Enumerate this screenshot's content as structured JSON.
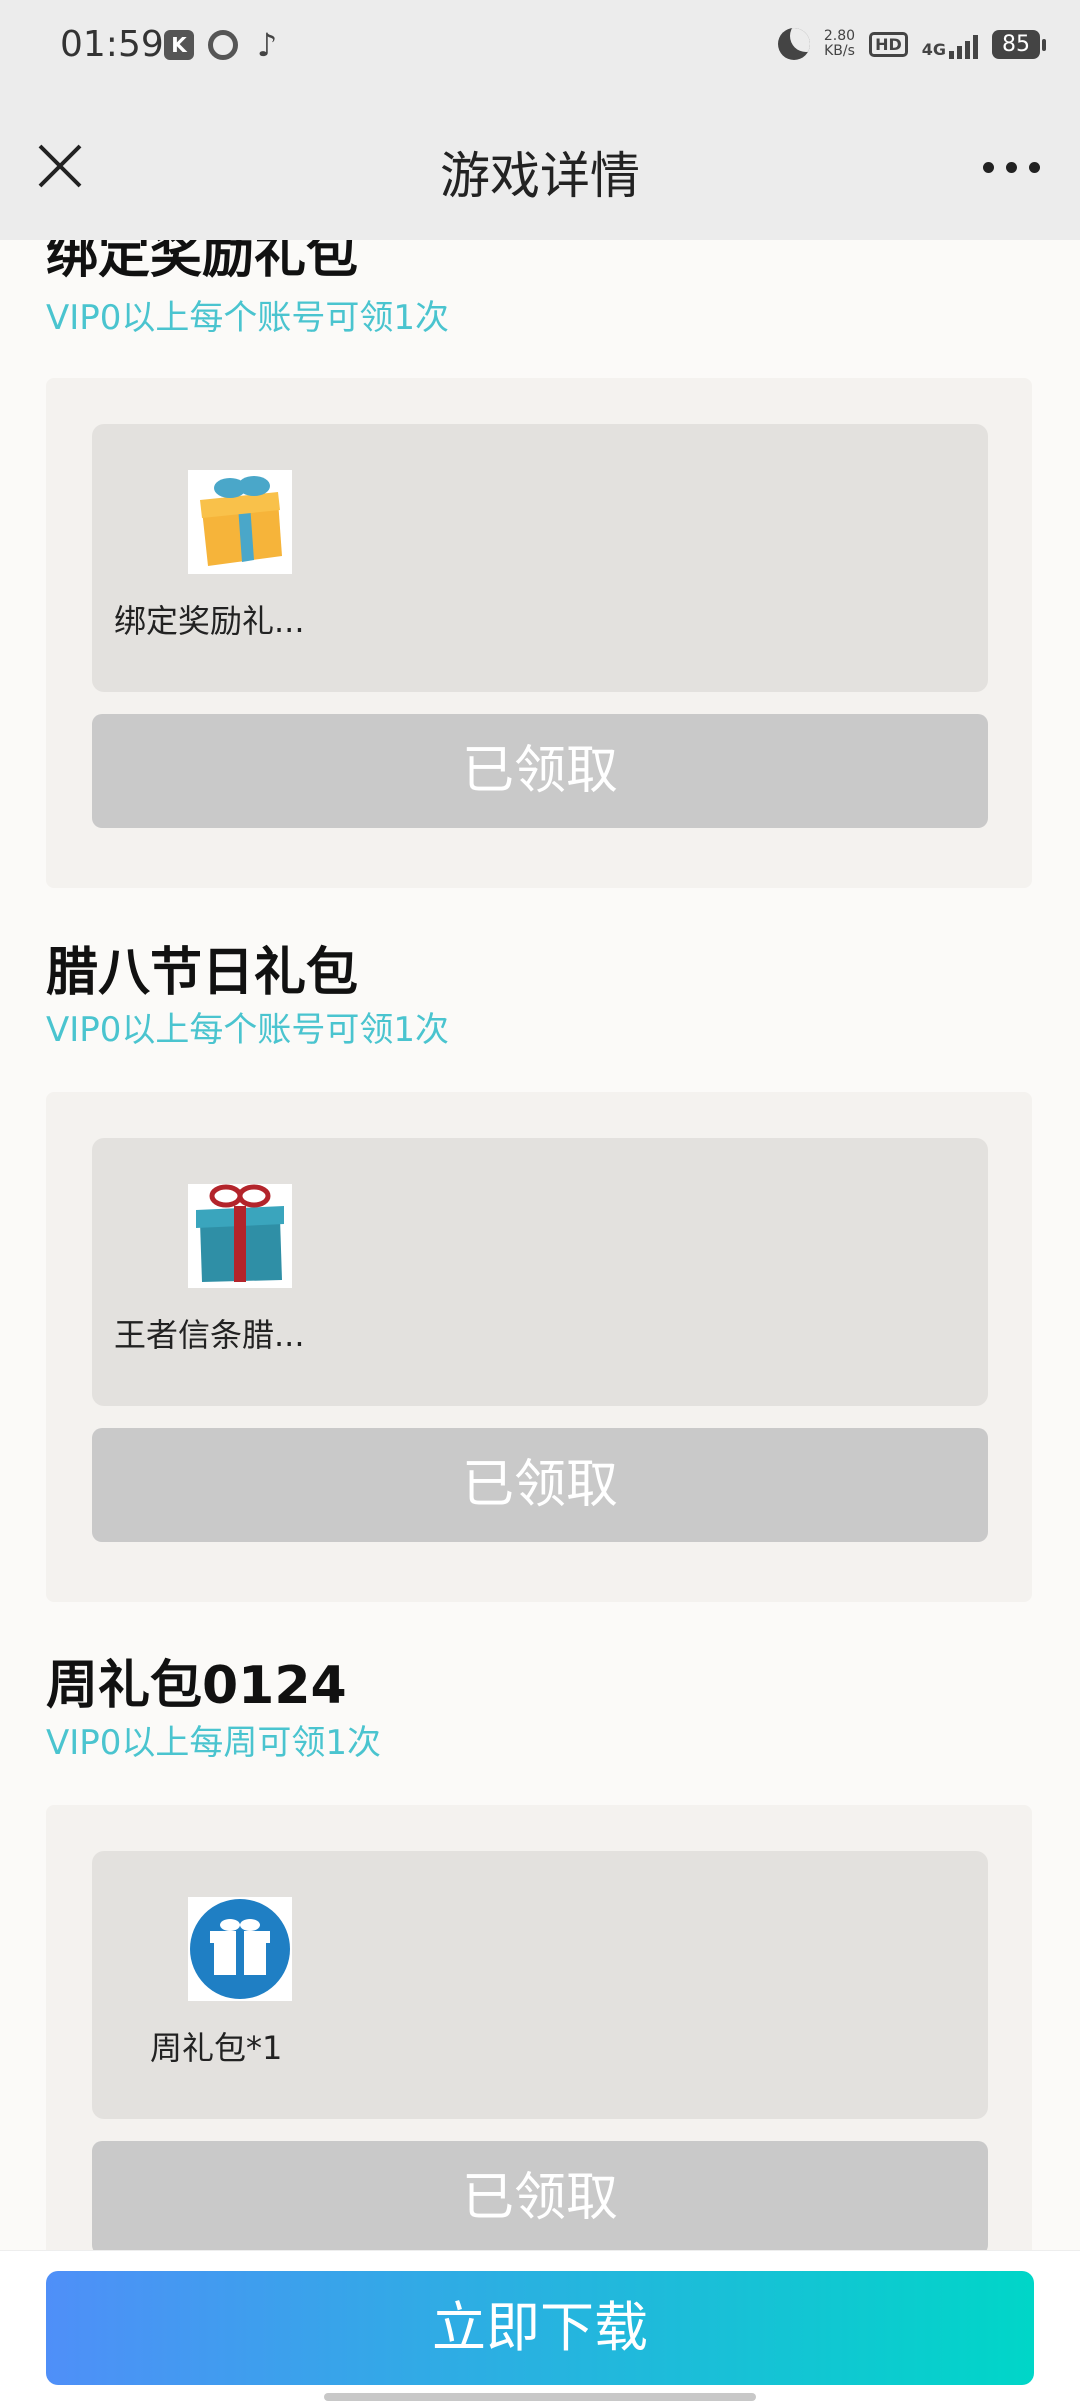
{
  "status": {
    "time": "01:59",
    "speed_value": "2.80",
    "speed_unit": "KB/s",
    "hd": "HD",
    "network": "4G",
    "battery": "85"
  },
  "nav": {
    "title": "游戏详情"
  },
  "sections": [
    {
      "title": "绑定奖励礼包",
      "subtitle": "VIP0以上每个账号可领1次",
      "item_name": "绑定奖励礼...",
      "item_icon": "yellow-gift-box-icon",
      "button": "已领取"
    },
    {
      "title": "腊八节日礼包",
      "subtitle": "VIP0以上每个账号可领1次",
      "item_name": "王者信条腊...",
      "item_icon": "teal-gift-box-icon",
      "button": "已领取"
    },
    {
      "title": "周礼包0124",
      "subtitle": "VIP0以上每周可领1次",
      "item_name": "周礼包*1",
      "item_icon": "blue-round-gift-icon",
      "button": "已领取"
    }
  ],
  "footer": {
    "download": "立即下载"
  },
  "colors": {
    "accent_teal": "#4ac4cf",
    "gradient_start": "#4f8ff8",
    "gradient_end": "#00d6c8",
    "claimed_button": "#c9c9c9"
  }
}
